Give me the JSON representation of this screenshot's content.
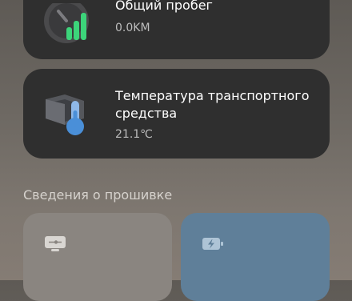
{
  "mileage_card": {
    "title": "Общий пробег",
    "value": "0.0KM",
    "icon": "speedometer-icon"
  },
  "temperature_card": {
    "title_line1": "Температура транспортного",
    "title_line2": "средства",
    "value": "21.1℃",
    "icon": "thermometer-icon"
  },
  "firmware_section": {
    "title": "Сведения о прошивке",
    "tiles": [
      {
        "icon": "monitor-icon"
      },
      {
        "icon": "battery-charging-icon"
      }
    ]
  },
  "colors": {
    "card_background": "#2f2f2f",
    "accent_green": "#3cd47a",
    "accent_blue": "#4a8fd8",
    "tile_gray": "#8a8580",
    "tile_blue": "#5f7f99"
  }
}
